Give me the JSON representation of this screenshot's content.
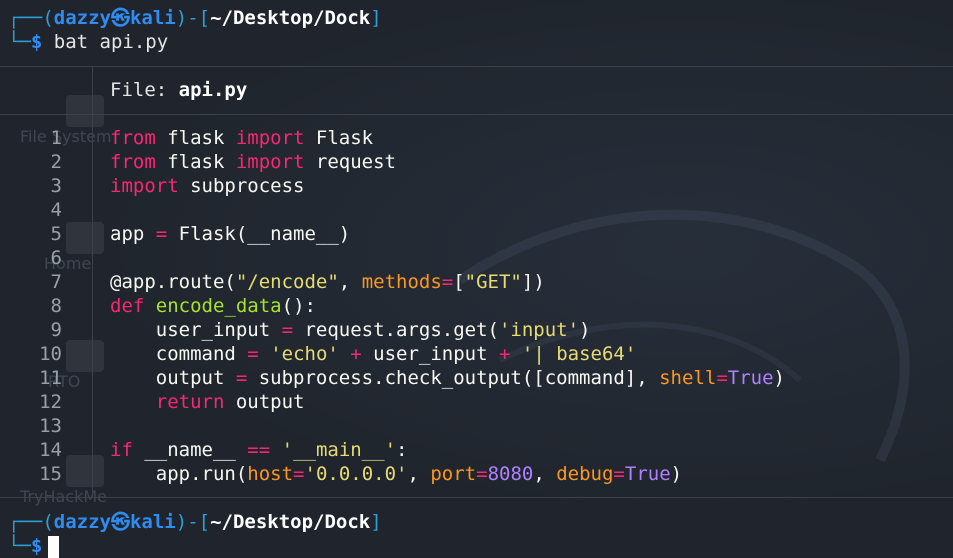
{
  "prompt": {
    "user": "dazzy",
    "host": "kali",
    "separator_glyph": "㉿",
    "path": "~/Desktop/Dock",
    "command": "bat api.py"
  },
  "desktop_icons": [
    "File System",
    "Home",
    "RTO",
    "TryHackMe"
  ],
  "file_header": {
    "label": "File: ",
    "name": "api.py"
  },
  "line_numbers": [
    "1",
    "2",
    "3",
    "4",
    "5",
    "6",
    "7",
    "8",
    "9",
    "10",
    "11",
    "12",
    "13",
    "14",
    "15"
  ],
  "code_lines": [
    [
      [
        "kw",
        "from"
      ],
      [
        "txt",
        " flask "
      ],
      [
        "kw",
        "import"
      ],
      [
        "txt",
        " Flask"
      ]
    ],
    [
      [
        "kw",
        "from"
      ],
      [
        "txt",
        " flask "
      ],
      [
        "kw",
        "import"
      ],
      [
        "txt",
        " request"
      ]
    ],
    [
      [
        "kw",
        "import"
      ],
      [
        "txt",
        " subprocess"
      ]
    ],
    [],
    [
      [
        "txt",
        "app "
      ],
      [
        "kw",
        "="
      ],
      [
        "txt",
        " Flask(__name__)"
      ]
    ],
    [],
    [
      [
        "txt",
        "@app.route("
      ],
      [
        "str",
        "\"/encode\""
      ],
      [
        "txt",
        ", "
      ],
      [
        "param",
        "methods"
      ],
      [
        "kw",
        "="
      ],
      [
        "txt",
        "["
      ],
      [
        "str",
        "\"GET\""
      ],
      [
        "txt",
        "])"
      ]
    ],
    [
      [
        "kw",
        "def"
      ],
      [
        "txt",
        " "
      ],
      [
        "fn",
        "encode_data"
      ],
      [
        "txt",
        "():"
      ]
    ],
    [
      [
        "txt",
        "    user_input "
      ],
      [
        "kw",
        "="
      ],
      [
        "txt",
        " request.args.get("
      ],
      [
        "str",
        "'input'"
      ],
      [
        "txt",
        ")"
      ]
    ],
    [
      [
        "txt",
        "    command "
      ],
      [
        "kw",
        "="
      ],
      [
        "txt",
        " "
      ],
      [
        "str",
        "'echo'"
      ],
      [
        "txt",
        " "
      ],
      [
        "kw",
        "+"
      ],
      [
        "txt",
        " user_input "
      ],
      [
        "kw",
        "+"
      ],
      [
        "txt",
        " "
      ],
      [
        "str",
        "'| base64'"
      ]
    ],
    [
      [
        "txt",
        "    output "
      ],
      [
        "kw",
        "="
      ],
      [
        "txt",
        " subprocess.check_output([command], "
      ],
      [
        "param",
        "shell"
      ],
      [
        "kw",
        "="
      ],
      [
        "const",
        "True"
      ],
      [
        "txt",
        ")"
      ]
    ],
    [
      [
        "txt",
        "    "
      ],
      [
        "kw",
        "return"
      ],
      [
        "txt",
        " output"
      ]
    ],
    [],
    [
      [
        "kw",
        "if"
      ],
      [
        "txt",
        " __name__ "
      ],
      [
        "kw",
        "=="
      ],
      [
        "txt",
        " "
      ],
      [
        "str",
        "'__main__'"
      ],
      [
        "txt",
        ":"
      ]
    ],
    [
      [
        "txt",
        "    app.run("
      ],
      [
        "param",
        "host"
      ],
      [
        "kw",
        "="
      ],
      [
        "str",
        "'0.0.0.0'"
      ],
      [
        "txt",
        ", "
      ],
      [
        "param",
        "port"
      ],
      [
        "kw",
        "="
      ],
      [
        "const",
        "8080"
      ],
      [
        "txt",
        ", "
      ],
      [
        "param",
        "debug"
      ],
      [
        "kw",
        "="
      ],
      [
        "const",
        "True"
      ],
      [
        "txt",
        ")"
      ]
    ]
  ],
  "colors": {
    "background": "#1f242c",
    "prompt_blue": "#2f8cf0",
    "keyword": "#f92672",
    "function": "#a6e22e",
    "string": "#e6db74",
    "parameter": "#fd971f",
    "constant": "#ae81ff"
  }
}
